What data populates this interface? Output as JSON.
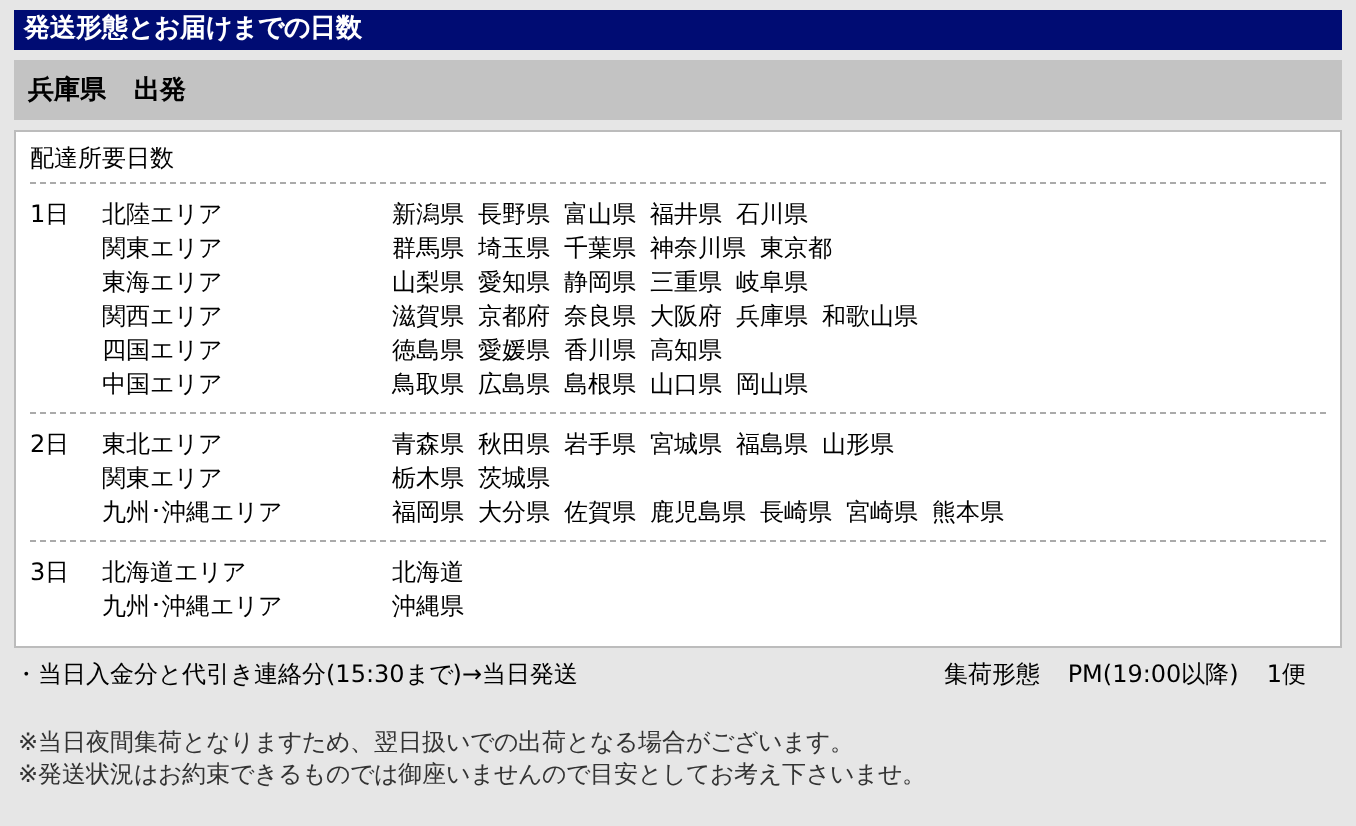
{
  "title": "発送形態とお届けまでの日数",
  "origin": {
    "prefecture": "兵庫県",
    "label": "出発"
  },
  "delivery": {
    "heading": "配達所要日数",
    "groups": [
      {
        "day": "1日",
        "areas": [
          {
            "name": "北陸エリア",
            "prefectures": [
              "新潟県",
              "長野県",
              "富山県",
              "福井県",
              "石川県"
            ]
          },
          {
            "name": "関東エリア",
            "prefectures": [
              "群馬県",
              "埼玉県",
              "千葉県",
              "神奈川県",
              "東京都"
            ]
          },
          {
            "name": "東海エリア",
            "prefectures": [
              "山梨県",
              "愛知県",
              "静岡県",
              "三重県",
              "岐阜県"
            ]
          },
          {
            "name": "関西エリア",
            "prefectures": [
              "滋賀県",
              "京都府",
              "奈良県",
              "大阪府",
              "兵庫県",
              "和歌山県"
            ]
          },
          {
            "name": "四国エリア",
            "prefectures": [
              "徳島県",
              "愛媛県",
              "香川県",
              "高知県"
            ]
          },
          {
            "name": "中国エリア",
            "prefectures": [
              "鳥取県",
              "広島県",
              "島根県",
              "山口県",
              "岡山県"
            ]
          }
        ]
      },
      {
        "day": "2日",
        "areas": [
          {
            "name": "東北エリア",
            "prefectures": [
              "青森県",
              "秋田県",
              "岩手県",
              "宮城県",
              "福島県",
              "山形県"
            ]
          },
          {
            "name": "関東エリア",
            "prefectures": [
              "栃木県",
              "茨城県"
            ]
          },
          {
            "name": "九州･沖縄エリア",
            "prefectures": [
              "福岡県",
              "大分県",
              "佐賀県",
              "鹿児島県",
              "長崎県",
              "宮崎県",
              "熊本県"
            ]
          }
        ]
      },
      {
        "day": "3日",
        "areas": [
          {
            "name": "北海道エリア",
            "prefectures": [
              "北海道"
            ]
          },
          {
            "name": "九州･沖縄エリア",
            "prefectures": [
              "沖縄県"
            ]
          }
        ]
      }
    ]
  },
  "shipping": {
    "condition": "・当日入金分と代引き連絡分(15:30まで)→当日発送",
    "pickup_label": "集荷形態",
    "pickup_time": "PM(19:00以降)",
    "pickup_count": "1便"
  },
  "notes": [
    "※当日夜間集荷となりますため、翌日扱いでの出荷となる場合がございます。",
    "※発送状況はお約束できるものでは御座いませんので目安としてお考え下さいませ。"
  ]
}
